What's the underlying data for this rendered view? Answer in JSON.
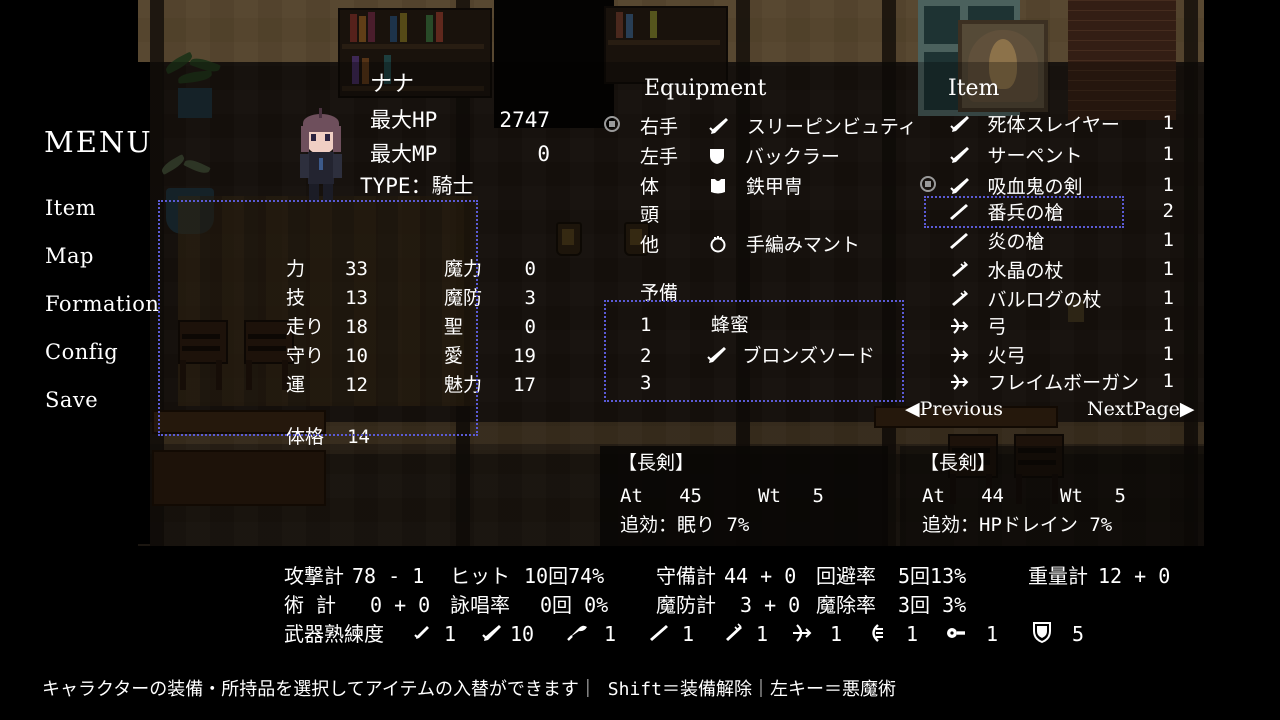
{
  "menu": {
    "title": "MENU",
    "items": [
      {
        "label": "Item"
      },
      {
        "label": "Map"
      },
      {
        "label": "Formation"
      },
      {
        "label": "Config"
      },
      {
        "label": "Save"
      }
    ]
  },
  "character": {
    "name": "ナナ",
    "max_hp_label": "最大HP",
    "max_hp_value": "2747",
    "max_mp_label": "最大MP",
    "max_mp_value": "0",
    "type_label": "TYPE：騎士",
    "stats_left": [
      {
        "label": "力",
        "value": "33"
      },
      {
        "label": "技",
        "value": "13"
      },
      {
        "label": "走り",
        "value": "18"
      },
      {
        "label": "守り",
        "value": "10"
      },
      {
        "label": "運",
        "value": "12"
      }
    ],
    "stats_right": [
      {
        "label": "魔力",
        "value": "0"
      },
      {
        "label": "魔防",
        "value": "3"
      },
      {
        "label": "聖",
        "value": "0"
      },
      {
        "label": "愛",
        "value": "19"
      },
      {
        "label": "魅力",
        "value": "17"
      }
    ],
    "build_label": "体格",
    "build_value": "14"
  },
  "equipment": {
    "title": "Equipment",
    "slots": [
      {
        "slot": "右手",
        "icon": "sword-icon",
        "name": "スリーピンビュティ",
        "selected": true
      },
      {
        "slot": "左手",
        "icon": "shield-icon",
        "name": "バックラー",
        "selected": false
      },
      {
        "slot": "体",
        "icon": "armor-icon",
        "name": "鉄甲冑",
        "selected": false
      },
      {
        "slot": "頭",
        "icon": "none",
        "name": "",
        "selected": false
      },
      {
        "slot": "他",
        "icon": "cloak-icon",
        "name": "手編みマント",
        "selected": false
      }
    ],
    "reserve_title": "予備",
    "reserve": [
      {
        "index": "1",
        "icon": "none",
        "name": "蜂蜜"
      },
      {
        "index": "2",
        "icon": "sword-icon",
        "name": "ブロンズソード"
      },
      {
        "index": "3",
        "icon": "none",
        "name": ""
      }
    ]
  },
  "items": {
    "title": "Item",
    "list": [
      {
        "icon": "sword-icon",
        "name": "死体スレイヤー",
        "qty": "1",
        "selected": false,
        "cursor": false
      },
      {
        "icon": "sword-icon",
        "name": "サーペント",
        "qty": "1",
        "selected": false,
        "cursor": false
      },
      {
        "icon": "sword-icon",
        "name": "吸血鬼の剣",
        "qty": "1",
        "selected": false,
        "cursor": true
      },
      {
        "icon": "spear-icon",
        "name": "番兵の槍",
        "qty": "2",
        "selected": true,
        "cursor": false
      },
      {
        "icon": "spear-icon",
        "name": "炎の槍",
        "qty": "1",
        "selected": false,
        "cursor": false
      },
      {
        "icon": "staff-icon",
        "name": "水晶の杖",
        "qty": "1",
        "selected": false,
        "cursor": false
      },
      {
        "icon": "staff-icon",
        "name": "バルログの杖",
        "qty": "1",
        "selected": false,
        "cursor": false
      },
      {
        "icon": "bow-icon",
        "name": "弓",
        "qty": "1",
        "selected": false,
        "cursor": false
      },
      {
        "icon": "bow-icon",
        "name": "火弓",
        "qty": "1",
        "selected": false,
        "cursor": false
      },
      {
        "icon": "bow-icon",
        "name": "フレイムボーガン",
        "qty": "1",
        "selected": false,
        "cursor": false
      }
    ],
    "prev_label": "Previous",
    "next_label": "NextPage"
  },
  "detail_left": {
    "category": "【長剣】",
    "at_label": "At",
    "at_value": "45",
    "wt_label": "Wt",
    "wt_value": "5",
    "effect": "追効：眠り 7%"
  },
  "detail_right": {
    "category": "【長剣】",
    "at_label": "At",
    "at_value": "44",
    "wt_label": "Wt",
    "wt_value": "5",
    "effect": "追効：HPドレイン 7%"
  },
  "summary": {
    "attack_label": "攻撃計",
    "attack_value": "78 - 1",
    "hit_label": "ヒット",
    "hit_value": "10回74%",
    "defense_label": "守備計",
    "defense_value": "44 + 0",
    "evade_label": "回避率",
    "evade_value": "5回13%",
    "weight_label": "重量計",
    "weight_value": "12 + 0",
    "magic_label": "術 計",
    "magic_value": "0 + 0",
    "cast_label": "詠唱率",
    "cast_value": "0回  0%",
    "mdef_label": "魔防計",
    "mdef_value": "3 + 0",
    "mresist_label": "魔除率",
    "mresist_value": "3回  3%",
    "proficiency_label": "武器熟練度",
    "proficiency": [
      {
        "icon": "dagger-icon",
        "value": "1"
      },
      {
        "icon": "sword-icon",
        "value": "10"
      },
      {
        "icon": "axe-icon",
        "value": "1"
      },
      {
        "icon": "spear-icon",
        "value": "1"
      },
      {
        "icon": "staff-icon",
        "value": "1"
      },
      {
        "icon": "bow-icon",
        "value": "1"
      },
      {
        "icon": "crossbow-icon",
        "value": "1"
      },
      {
        "icon": "gun-icon",
        "value": "1"
      },
      {
        "icon": "shield-icon",
        "value": "5"
      }
    ]
  },
  "help": {
    "text": "キャラクターの装備・所持品を選択してアイテムの入替ができます｜ Shift＝装備解除｜左キー＝悪魔術"
  },
  "colors": {
    "text": "#ffffff",
    "selection_border": "#5b5bd6",
    "panel_bg": "#000000",
    "wall": "#7a6240",
    "floor": "#2e2419"
  }
}
